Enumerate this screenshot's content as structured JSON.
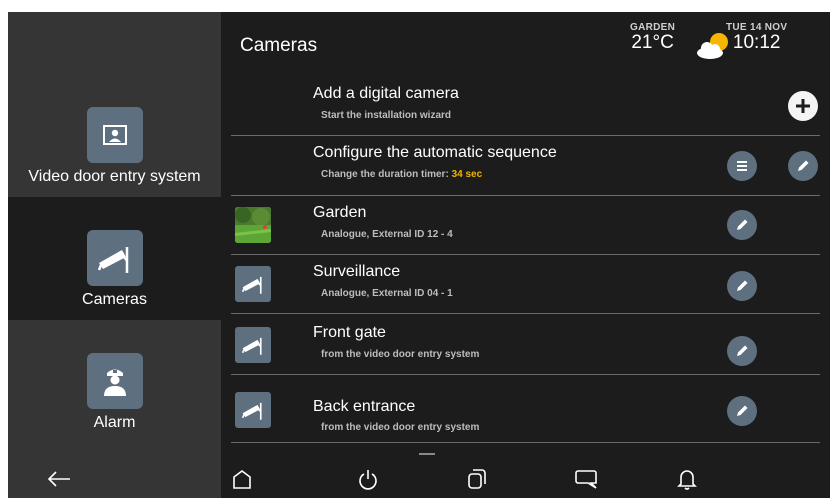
{
  "header": {
    "title": "Cameras",
    "weather": {
      "label": "GARDEN",
      "temperature": "21°C",
      "icon": "partly-cloudy-icon"
    },
    "datetime": {
      "date": "TUE 14 NOV",
      "time": "10:12"
    }
  },
  "sidebar": {
    "items": [
      {
        "label": "Video door entry system",
        "icon": "video-door-icon",
        "active": false
      },
      {
        "label": "Cameras",
        "icon": "camera-icon",
        "active": true
      },
      {
        "label": "Alarm",
        "icon": "alarm-guard-icon",
        "active": false
      }
    ]
  },
  "list": {
    "add": {
      "title": "Add a digital camera",
      "subtitle": "Start the installation wizard",
      "action_icon": "plus-icon"
    },
    "sequence": {
      "title": "Configure the automatic sequence",
      "subtitle_prefix": "Change the duration timer: ",
      "subtitle_value": "34 sec"
    },
    "cameras": [
      {
        "name": "Garden",
        "description": "Analogue, External ID 12 - 4",
        "thumbnail": "garden-photo"
      },
      {
        "name": "Surveillance",
        "description": "Analogue, External ID 04 - 1",
        "thumbnail": "camera-icon"
      },
      {
        "name": "Front gate",
        "description": "from the video door entry system",
        "thumbnail": "camera-icon"
      },
      {
        "name": "Back entrance",
        "description": "from the video door entry system",
        "thumbnail": "camera-icon"
      }
    ]
  },
  "bottom_nav": {
    "items": [
      "back-arrow-icon",
      "home-icon",
      "power-icon",
      "windows-icon",
      "message-icon",
      "bell-icon"
    ]
  },
  "colors": {
    "accent": "#5e7080",
    "highlight": "#f2b200",
    "sidebar": "#353535",
    "background": "#1c1c1c"
  }
}
